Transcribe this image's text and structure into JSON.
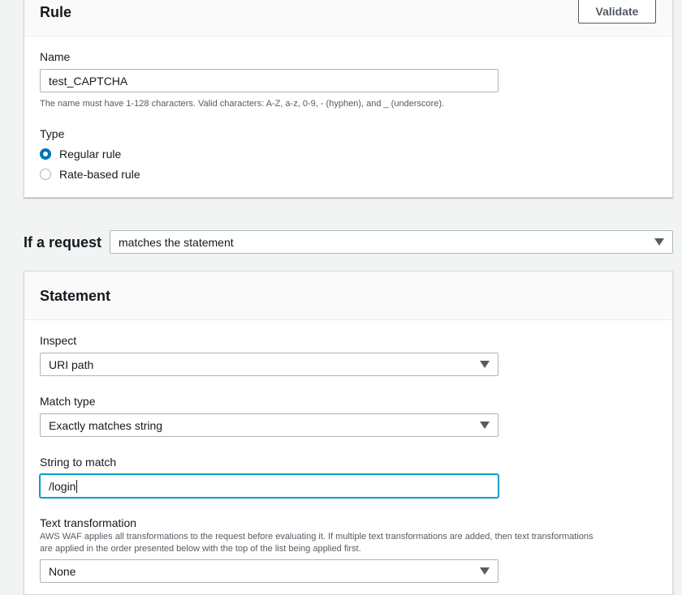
{
  "rule": {
    "title": "Rule",
    "validate_label": "Validate",
    "name_label": "Name",
    "name_value": "test_CAPTCHA",
    "name_hint": "The name must have 1-128 characters. Valid characters: A-Z, a-z, 0-9, - (hyphen), and _ (underscore).",
    "type_label": "Type",
    "type_options": [
      {
        "label": "Regular rule",
        "checked": true
      },
      {
        "label": "Rate-based rule",
        "checked": false
      }
    ]
  },
  "request": {
    "label": "If a request",
    "selected": "matches the statement"
  },
  "statement": {
    "title": "Statement",
    "inspect_label": "Inspect",
    "inspect_value": "URI path",
    "match_type_label": "Match type",
    "match_type_value": "Exactly matches string",
    "string_label": "String to match",
    "string_value": "/login",
    "transform_label": "Text transformation",
    "transform_hint": "AWS WAF applies all transformations to the request before evaluating it. If multiple text transformations are added, then text transformations are applied in the order presented below with the top of the list being applied first.",
    "transform_value": "None"
  },
  "colors": {
    "accent": "#0073bb",
    "focus": "#00a1c9",
    "background": "#f2f3f3"
  }
}
